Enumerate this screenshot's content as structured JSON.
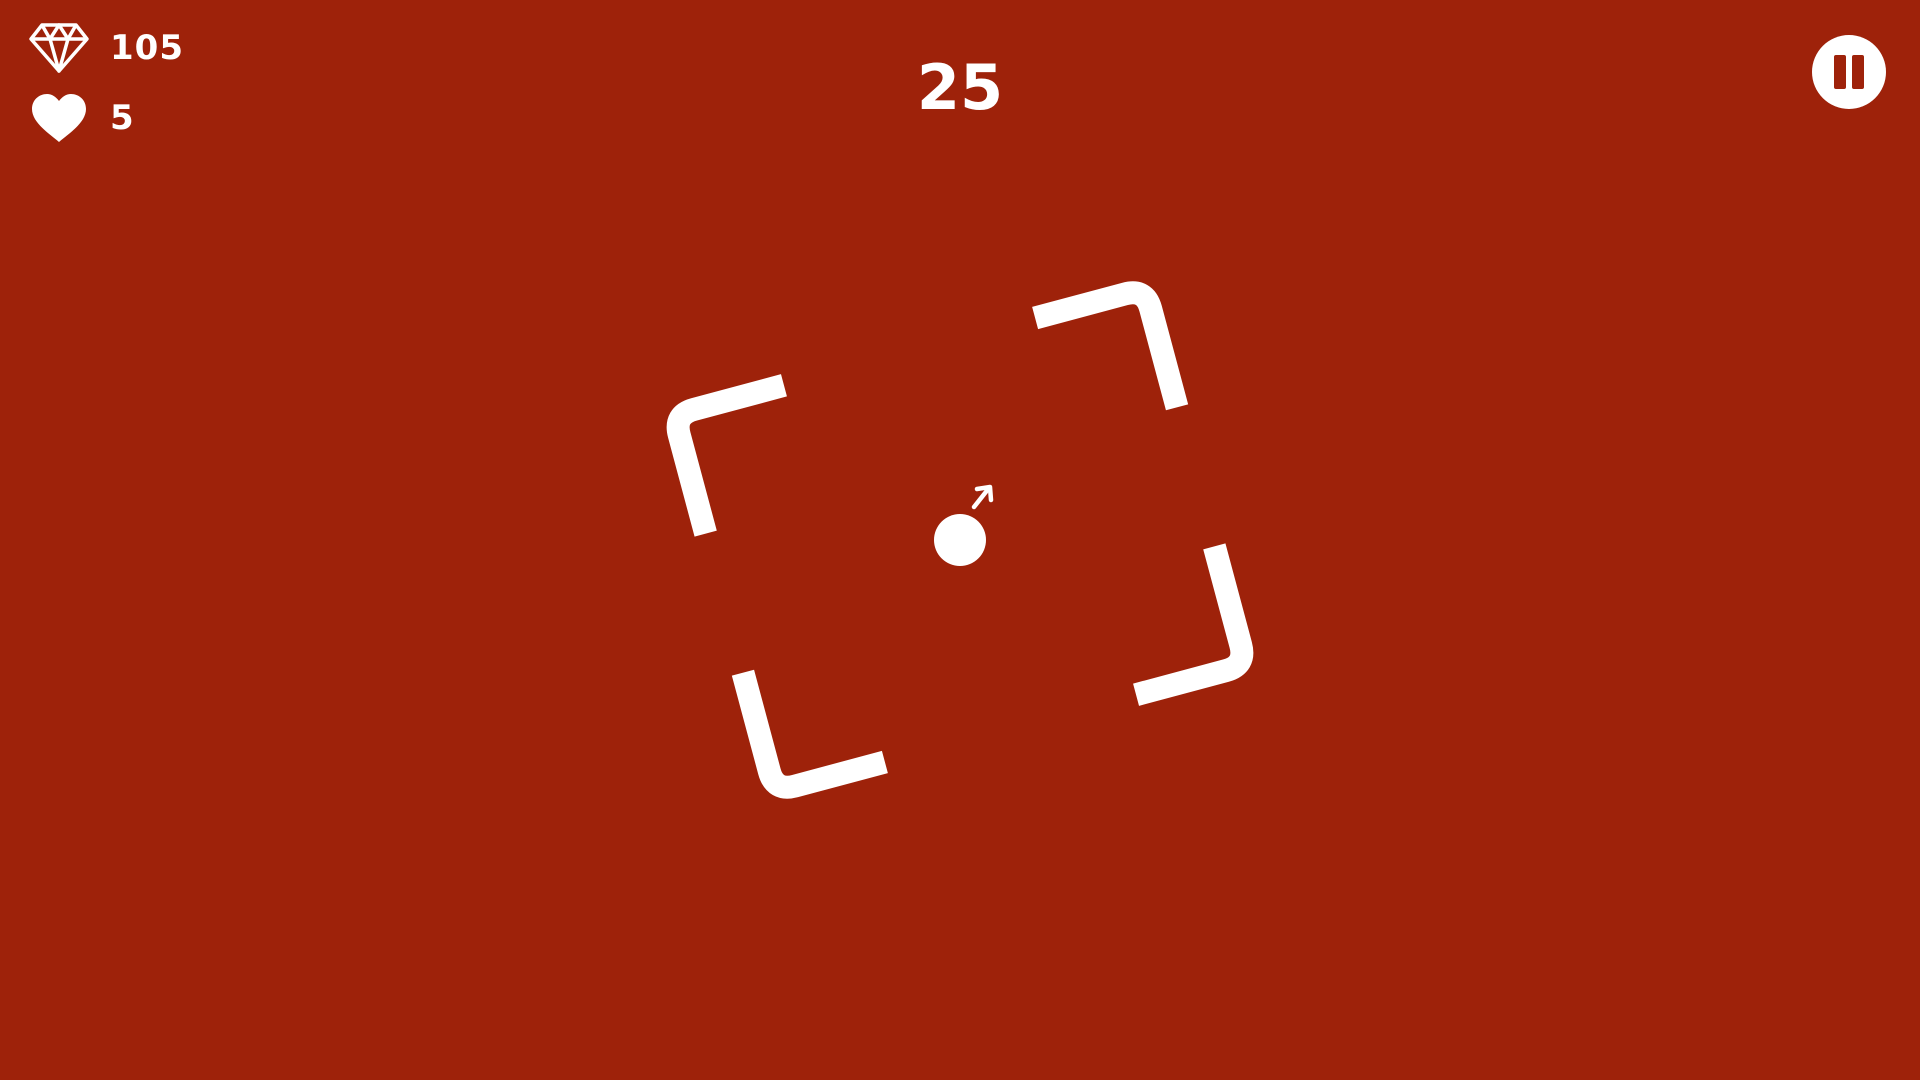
{
  "theme": {
    "background": "#9E220A",
    "foreground": "#FFFFFF"
  },
  "hud": {
    "gems": {
      "icon": "diamond-icon",
      "count": "105"
    },
    "lives": {
      "icon": "heart-icon",
      "count": "5"
    },
    "score": "25",
    "pause": {
      "icon": "pause-icon"
    }
  },
  "playfield": {
    "frame": {
      "rotation_deg": -15,
      "corners": 4
    },
    "ball": {
      "shape": "circle",
      "direction_indicator": "arrow-up-right-icon"
    }
  }
}
